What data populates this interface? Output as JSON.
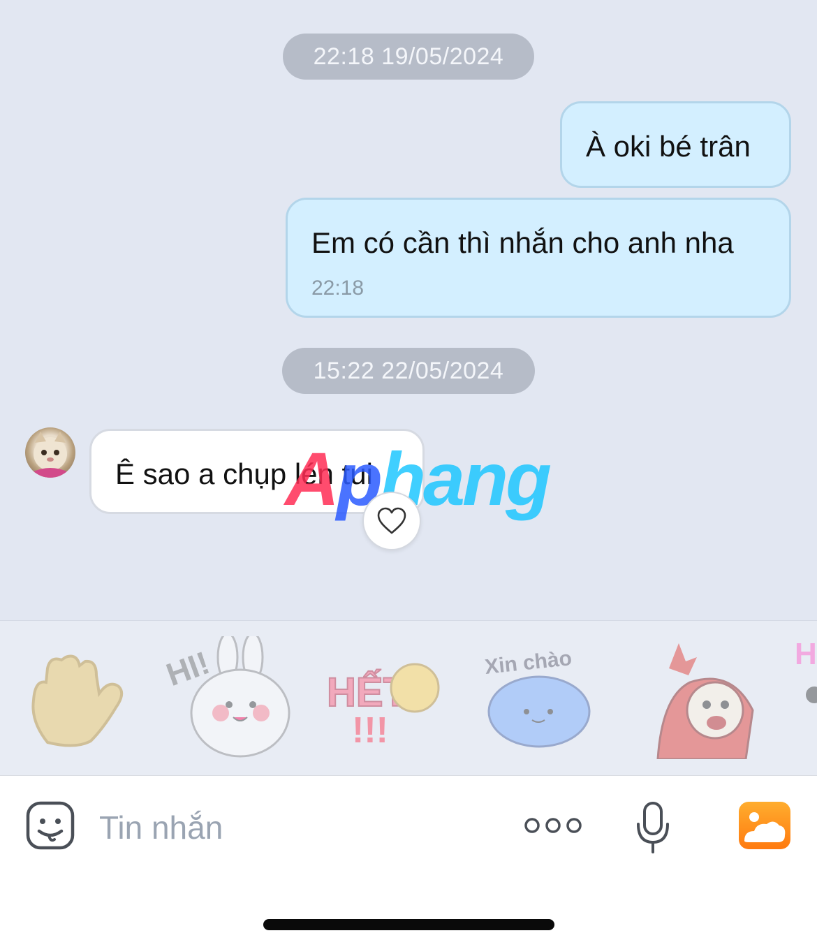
{
  "chat": {
    "time_pill_1": "22:18 19/05/2024",
    "time_pill_2": "15:22 22/05/2024",
    "messages": [
      {
        "direction": "out",
        "text": "À oki bé trân",
        "time": ""
      },
      {
        "direction": "out",
        "text": "Em có cần thì nhắn cho anh nha",
        "time": "22:18"
      },
      {
        "direction": "in",
        "text": "Ê sao a chụp lén tui",
        "time": ""
      }
    ]
  },
  "watermark": {
    "part1": "A",
    "part2": "p",
    "part3": "hang"
  },
  "stickers": {
    "items": [
      "wave-hand-sticker",
      "hi-bunny-sticker",
      "het-sticker",
      "xin-chao-sticker",
      "monkey-sticker",
      "partial-sticker"
    ],
    "xin_chao_label": "Xin chào",
    "hi_label": "HI!",
    "het_label": "HẾT"
  },
  "input": {
    "placeholder": "Tin nhắn"
  },
  "colors": {
    "background": "#e2e7f2",
    "outgoing_bubble": "#d3efff",
    "incoming_bubble": "#ffffff",
    "time_pill": "#b6bcc8",
    "gallery_icon": "#ff8c1a"
  }
}
